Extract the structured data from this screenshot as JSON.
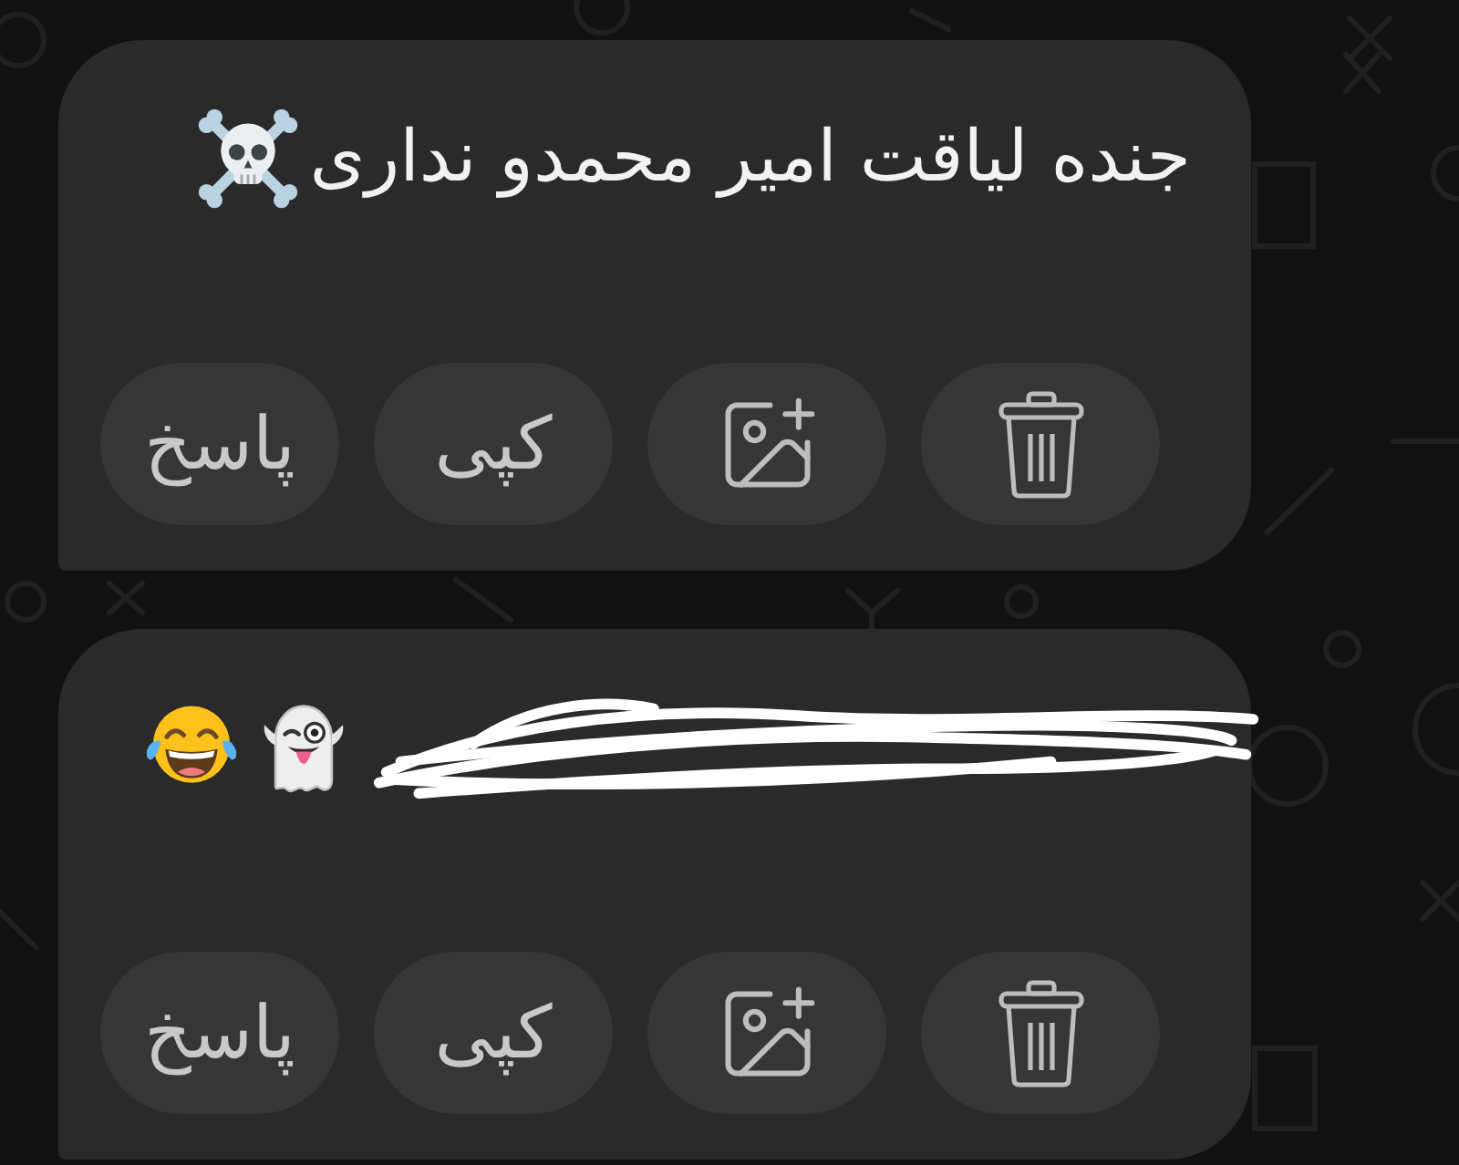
{
  "messages": [
    {
      "text": "جنده لیاقت امیر محمدو نداری",
      "redacted": false,
      "actions": [
        {
          "kind": "delete"
        },
        {
          "kind": "add-image"
        },
        {
          "kind": "copy",
          "label": "کپی"
        },
        {
          "kind": "reply",
          "label": "پاسخ"
        }
      ]
    },
    {
      "redacted": true,
      "actions": [
        {
          "kind": "delete"
        },
        {
          "kind": "add-image"
        },
        {
          "kind": "copy",
          "label": "کپی"
        },
        {
          "kind": "reply",
          "label": "پاسخ"
        }
      ]
    }
  ]
}
